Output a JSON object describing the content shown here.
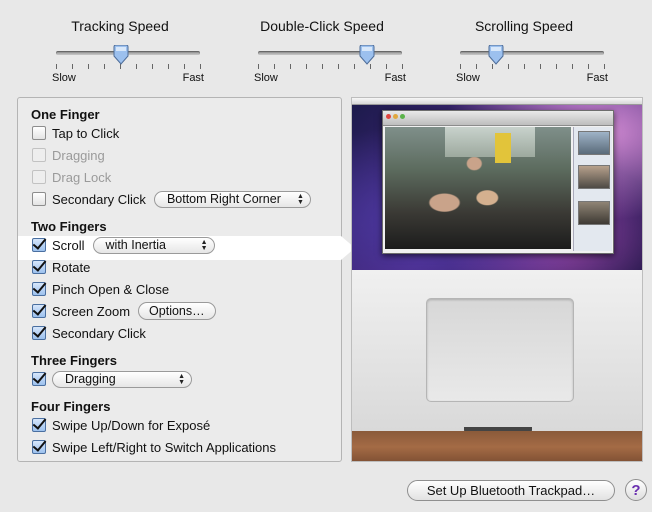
{
  "sliders": [
    {
      "id": "tracking",
      "title": "Tracking Speed",
      "min_label": "Slow",
      "max_label": "Fast",
      "value": 0.45
    },
    {
      "id": "double-click",
      "title": "Double-Click Speed",
      "min_label": "Slow",
      "max_label": "Fast",
      "value": 0.76
    },
    {
      "id": "scrolling",
      "title": "Scrolling Speed",
      "min_label": "Slow",
      "max_label": "Fast",
      "value": 0.25
    }
  ],
  "one_finger": {
    "title": "One Finger",
    "tap_to_click": {
      "label": "Tap to Click",
      "checked": false
    },
    "dragging": {
      "label": "Dragging",
      "checked": false,
      "enabled": false
    },
    "drag_lock": {
      "label": "Drag Lock",
      "checked": false,
      "enabled": false
    },
    "secondary_click": {
      "label": "Secondary Click",
      "checked": false,
      "option": "Bottom Right Corner"
    }
  },
  "two_fingers": {
    "title": "Two Fingers",
    "scroll": {
      "label": "Scroll",
      "checked": true,
      "option": "with Inertia"
    },
    "rotate": {
      "label": "Rotate",
      "checked": true
    },
    "pinch": {
      "label": "Pinch Open & Close",
      "checked": true
    },
    "screen_zoom": {
      "label": "Screen Zoom",
      "checked": true,
      "button": "Options…"
    },
    "secondary_click": {
      "label": "Secondary Click",
      "checked": true
    }
  },
  "three_fingers": {
    "title": "Three Fingers",
    "dragging": {
      "checked": true,
      "option": "Dragging"
    }
  },
  "four_fingers": {
    "title": "Four Fingers",
    "swipe_updown": {
      "label": "Swipe Up/Down for Exposé",
      "checked": true
    },
    "swipe_leftright": {
      "label": "Swipe Left/Right to Switch Applications",
      "checked": true
    }
  },
  "footer": {
    "setup_button": "Set Up Bluetooth Trackpad…",
    "help": "?"
  },
  "colors": {
    "accent": "#4a6fa0",
    "help": "#6a2fb0"
  }
}
